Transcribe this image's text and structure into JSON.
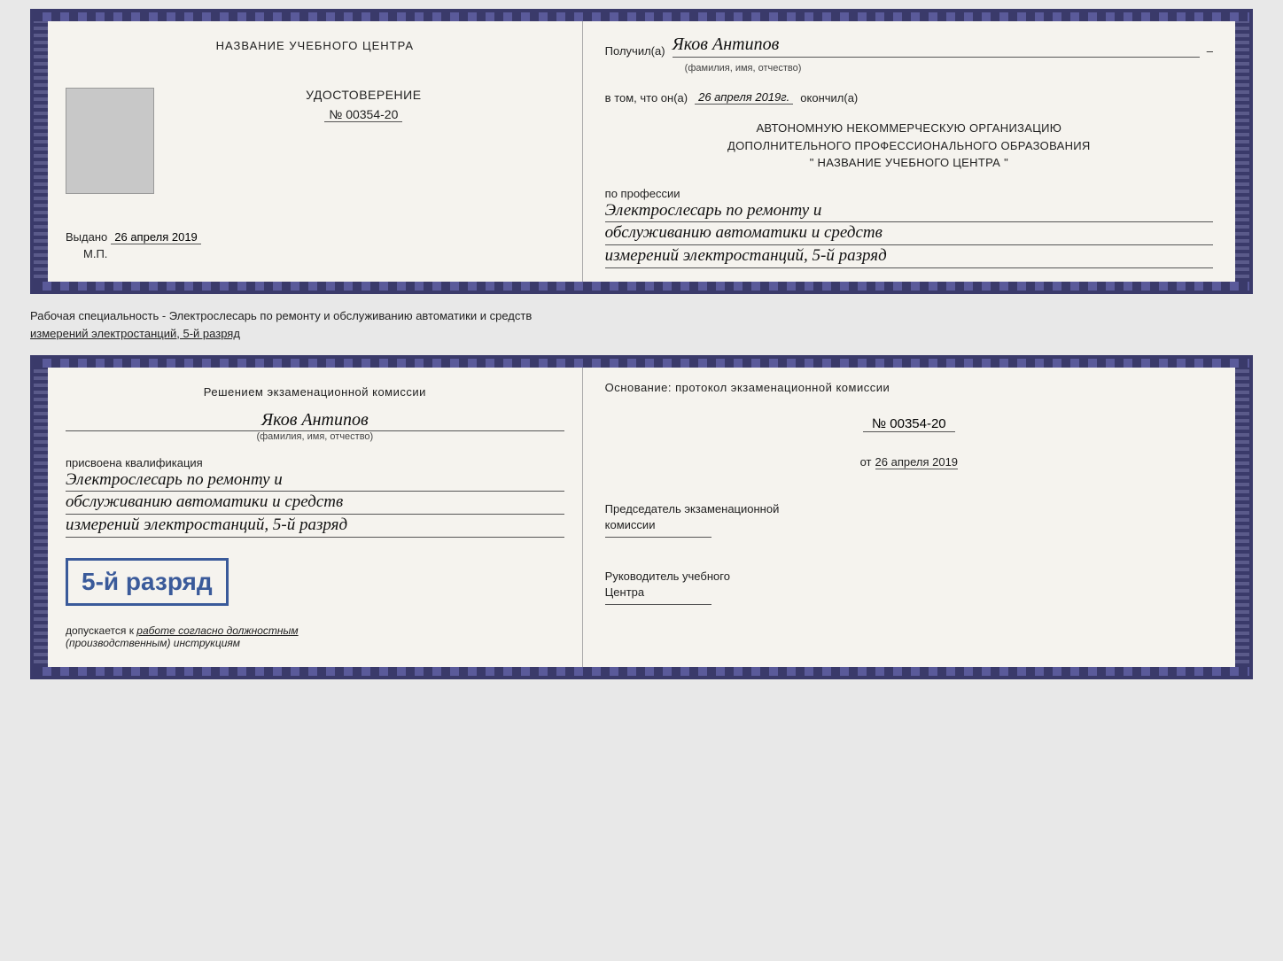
{
  "page": {
    "background": "#e8e8e8"
  },
  "top_cert": {
    "left": {
      "org_name": "НАЗВАНИЕ УЧЕБНОГО ЦЕНТРА",
      "cert_title": "УДОСТОВЕРЕНИЕ",
      "cert_number_prefix": "№",
      "cert_number": "00354-20",
      "issued_label": "Выдано",
      "issued_date": "26 апреля 2019",
      "mp_label": "М.П."
    },
    "right": {
      "recipient_label": "Получил(а)",
      "recipient_name": "Яков Антипов",
      "recipient_sub": "(фамилия, имя, отчество)",
      "line1_prefix": "в том, что он(а)",
      "line1_date": "26 апреля 2019г.",
      "line1_suffix": "окончил(а)",
      "org_block_line1": "АВТОНОМНУЮ НЕКОММЕРЧЕСКУЮ ОРГАНИЗАЦИЮ",
      "org_block_line2": "ДОПОЛНИТЕЛЬНОГО ПРОФЕССИОНАЛЬНОГО ОБРАЗОВАНИЯ",
      "org_block_line3": "\"   НАЗВАНИЕ УЧЕБНОГО ЦЕНТРА   \"",
      "profession_label": "по профессии",
      "profession_line1": "Электрослесарь по ремонту и",
      "profession_line2": "обслуживанию автоматики и средств",
      "profession_line3": "измерений электростанций, 5-й разряд"
    }
  },
  "specialty_text": {
    "line1": "Рабочая специальность - Электрослесарь по ремонту и обслуживанию автоматики и средств",
    "line2": "измерений электростанций, 5-й разряд"
  },
  "bottom_cert": {
    "left": {
      "commission_title": "Решением экзаменационной комиссии",
      "person_name": "Яков Антипов",
      "person_sub": "(фамилия, имя, отчество)",
      "qualification_label": "присвоена квалификация",
      "qual_line1": "Электрослесарь по ремонту и",
      "qual_line2": "обслуживанию автоматики и средств",
      "qual_line3": "измерений электростанций, 5-й разряд",
      "rank_text": "5-й разряд",
      "допускается_prefix": "допускается к",
      "допускается_italic": "работе согласно должностным",
      "допускается_italic2": "(производственным) инструкциям"
    },
    "right": {
      "osnov_label": "Основание: протокол экзаменационной  комиссии",
      "prot_number": "№  00354-20",
      "prot_date_prefix": "от",
      "prot_date": "26 апреля 2019",
      "chairman_label1": "Председатель экзаменационной",
      "chairman_label2": "комиссии",
      "head_label1": "Руководитель учебного",
      "head_label2": "Центра"
    }
  }
}
